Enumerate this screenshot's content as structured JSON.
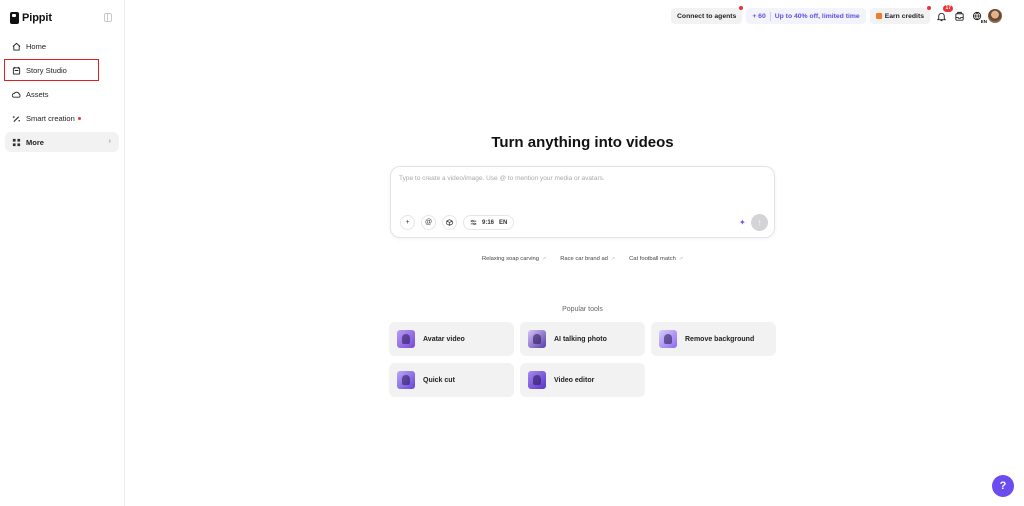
{
  "brand": {
    "name": "Pippit"
  },
  "sidebar": {
    "items": [
      {
        "label": "Home",
        "icon": "home-icon"
      },
      {
        "label": "Story Studio",
        "icon": "story-icon"
      },
      {
        "label": "Assets",
        "icon": "cloud-icon"
      },
      {
        "label": "Smart creation",
        "icon": "magic-wand-icon",
        "has_new_dot": true
      },
      {
        "label": "More",
        "icon": "grid-icon"
      }
    ]
  },
  "topbar": {
    "connect_label": "Connect to agents",
    "promo_credits": "+ 60",
    "promo_text": "Up to 40% off, limited time",
    "earn_label": "Earn credits",
    "notification_count": "17",
    "lang_code": "EN"
  },
  "main": {
    "headline": "Turn anything into videos",
    "prompt_placeholder": "Type to create a video/image. Use @ to mention your media or avatars.",
    "toolbar": {
      "add": "+",
      "mention": "@",
      "ratio": "9:16",
      "language": "EN"
    },
    "suggestions": [
      "Relaxing soap carving",
      "Race car brand ad",
      "Cat football match"
    ],
    "popular_title": "Popular tools",
    "tools": [
      {
        "label": "Avatar video"
      },
      {
        "label": "AI talking photo"
      },
      {
        "label": "Remove background"
      },
      {
        "label": "Quick cut"
      },
      {
        "label": "Video editor"
      }
    ]
  },
  "help": {
    "label": "?"
  },
  "colors": {
    "accent": "#6a4cf0",
    "highlight_border": "#d92323",
    "red_dot": "#e8353b"
  }
}
